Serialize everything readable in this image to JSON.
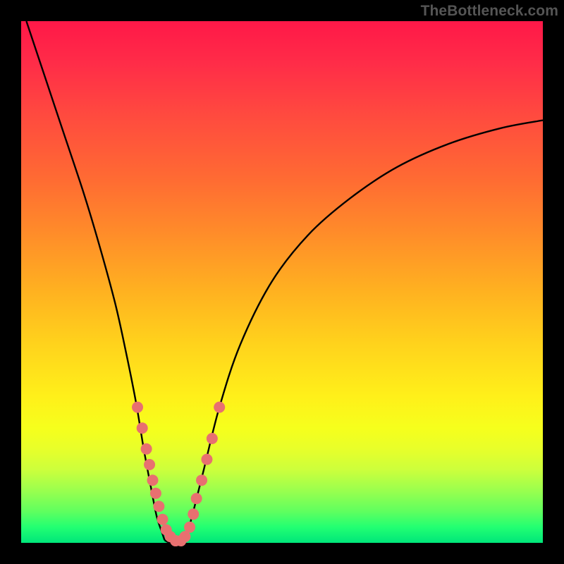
{
  "watermark": "TheBottleneck.com",
  "chart_data": {
    "type": "line",
    "title": "",
    "xlabel": "",
    "ylabel": "",
    "xlim": [
      0,
      100
    ],
    "ylim": [
      0,
      100
    ],
    "grid": false,
    "series": [
      {
        "name": "left-curve",
        "x": [
          1,
          5,
          8,
          12,
          15,
          18,
          20,
          22,
          23.5,
          25,
          26,
          27,
          27.5
        ],
        "y": [
          100,
          88,
          79,
          67,
          57,
          46,
          37,
          27,
          18,
          10,
          5,
          2,
          0.5
        ]
      },
      {
        "name": "valley-floor",
        "x": [
          27.5,
          28.5,
          29.5,
          30.5,
          31.5
        ],
        "y": [
          0.5,
          0,
          0,
          0,
          0.5
        ]
      },
      {
        "name": "right-curve",
        "x": [
          31.5,
          33,
          35,
          38,
          42,
          48,
          55,
          63,
          72,
          82,
          92,
          100
        ],
        "y": [
          0.5,
          6,
          14,
          26,
          38,
          50,
          59,
          66,
          72,
          76.5,
          79.5,
          81
        ]
      }
    ],
    "markers": {
      "name": "data-dots",
      "x": [
        22.3,
        23.2,
        24.0,
        24.6,
        25.2,
        25.8,
        26.4,
        27.1,
        27.8,
        28.6,
        29.6,
        30.6,
        31.4,
        32.3,
        33.0,
        33.6,
        34.6,
        35.6,
        36.6,
        38.0
      ],
      "y": [
        26.0,
        22.0,
        18.0,
        15.0,
        12.0,
        9.5,
        7.0,
        4.5,
        2.5,
        1.2,
        0.4,
        0.4,
        1.2,
        3.0,
        5.5,
        8.5,
        12.0,
        16.0,
        20.0,
        26.0
      ],
      "color": "#e87070",
      "radius": 8
    },
    "curve_stroke": "#000000",
    "curve_width": 2.4
  }
}
